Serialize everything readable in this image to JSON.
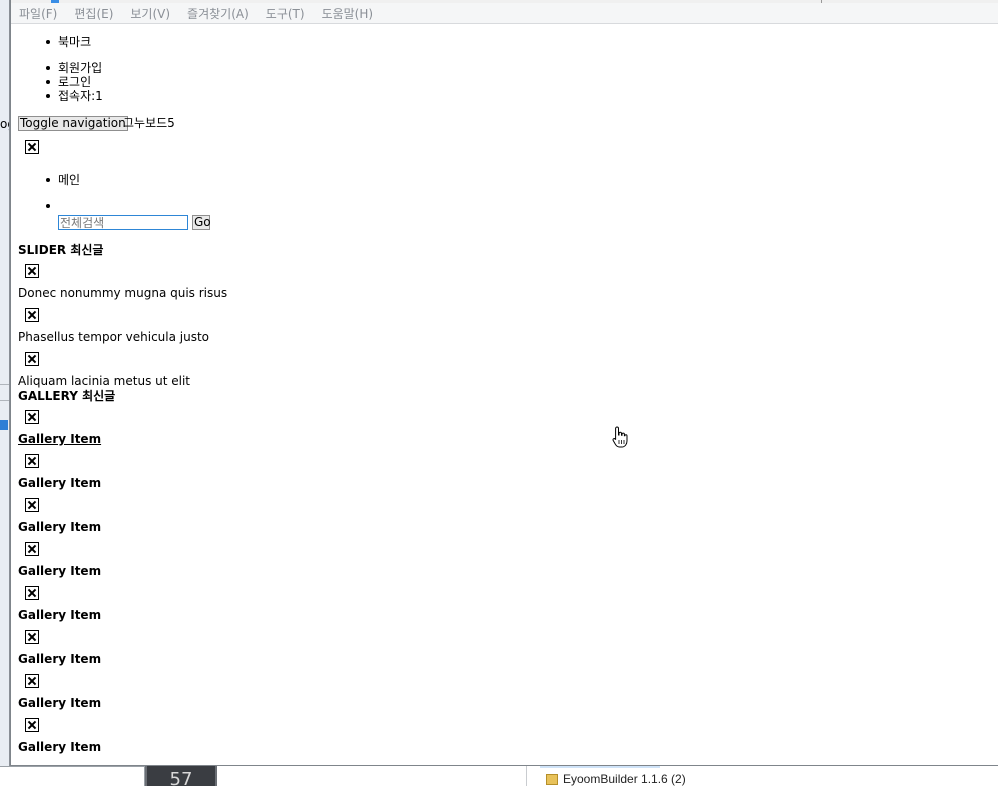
{
  "menubar": {
    "items": [
      "파일(F)",
      "편집(E)",
      "보기(V)",
      "즐겨찾기(A)",
      "도구(T)",
      "도움말(H)"
    ]
  },
  "page": {
    "top_list": [
      "북마크"
    ],
    "user_list": [
      "회원가입",
      "로그인",
      "접속자:1"
    ],
    "nav_toggle_label": "Toggle navigation",
    "brand": "그누보드5",
    "main_nav": [
      "메인"
    ],
    "search": {
      "value": "전체검색",
      "go_label": "Go"
    },
    "slider": {
      "heading": "SLIDER 최신글",
      "items": [
        "Donec nonummy mugna quis risus",
        "Phasellus tempor vehicula justo",
        "Aliquam lacinia metus ut elit"
      ]
    },
    "gallery": {
      "heading": "GALLERY 최신글",
      "items": [
        "Gallery Item",
        "Gallery Item",
        "Gallery Item",
        "Gallery Item",
        "Gallery Item",
        "Gallery Item",
        "Gallery Item",
        "Gallery Item"
      ]
    }
  },
  "background": {
    "taskbar_number": "57",
    "folder_item": "EyoomBuilder 1.1.6 (2)",
    "left_clip_text": "og"
  },
  "icons": {
    "broken_image": "broken-image-icon",
    "cursor": "hand-pointer-icon",
    "folder": "folder-icon"
  }
}
